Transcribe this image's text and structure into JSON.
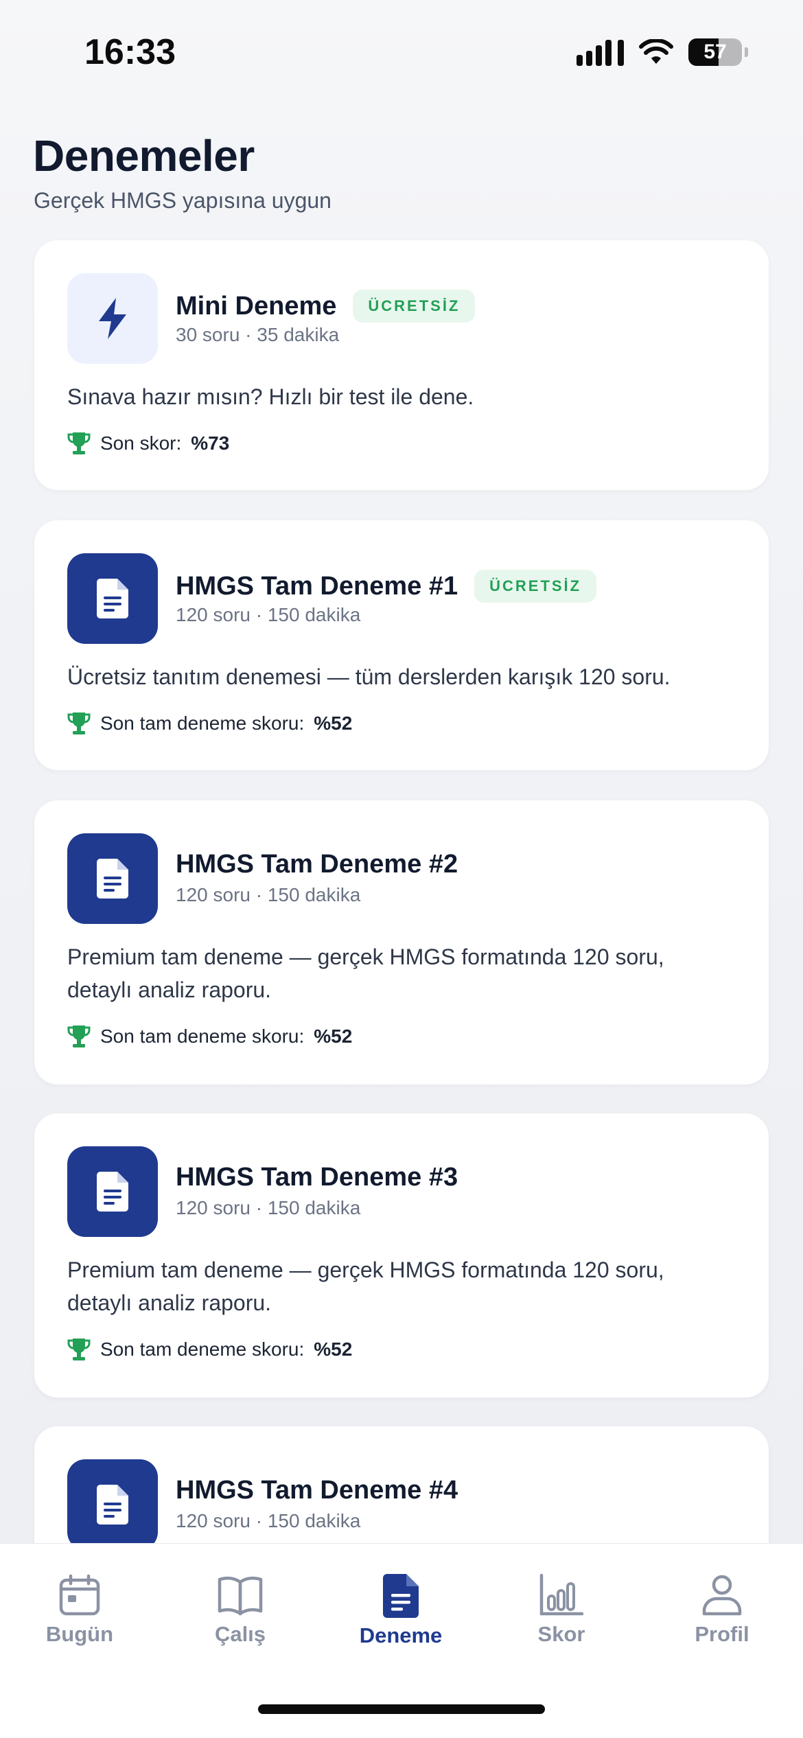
{
  "status_bar": {
    "time": "16:33",
    "battery_level": "57",
    "battery_fraction": 0.57
  },
  "header": {
    "title": "Denemeler",
    "subtitle": "Gerçek HMGS yapısına uygun"
  },
  "cards": [
    {
      "icon": "bolt-icon",
      "title": "Mini Deneme",
      "badge": "ÜCRETSİZ",
      "meta": "30 soru · 35 dakika",
      "description": "Sınava hazır mısın? Hızlı bir test ile dene.",
      "score_label": "Son skor:",
      "score_value": "%73"
    },
    {
      "icon": "document-icon",
      "title": "HMGS Tam Deneme #1",
      "badge": "ÜCRETSİZ",
      "meta": "120 soru · 150 dakika",
      "description": "Ücretsiz tanıtım denemesi — tüm derslerden karışık 120 soru.",
      "score_label": "Son tam deneme skoru:",
      "score_value": "%52"
    },
    {
      "icon": "document-icon",
      "title": "HMGS Tam Deneme #2",
      "meta": "120 soru · 150 dakika",
      "description": "Premium tam deneme — gerçek HMGS formatında 120 soru, detaylı analiz raporu.",
      "score_label": "Son tam deneme skoru:",
      "score_value": "%52"
    },
    {
      "icon": "document-icon",
      "title": "HMGS Tam Deneme #3",
      "meta": "120 soru · 150 dakika",
      "description": "Premium tam deneme — gerçek HMGS formatında 120 soru, detaylı analiz raporu.",
      "score_label": "Son tam deneme skoru:",
      "score_value": "%52"
    },
    {
      "icon": "document-icon",
      "title": "HMGS Tam Deneme #4",
      "meta": "120 soru · 150 dakika"
    }
  ],
  "tabs": [
    {
      "label": "Bugün",
      "icon": "calendar-icon",
      "active": false
    },
    {
      "label": "Çalış",
      "icon": "book-icon",
      "active": false
    },
    {
      "label": "Deneme",
      "icon": "document-icon",
      "active": true
    },
    {
      "label": "Skor",
      "icon": "bar-chart-icon",
      "active": false
    },
    {
      "label": "Profil",
      "icon": "user-icon",
      "active": false
    }
  ],
  "colors": {
    "primary": "#1f3a8f",
    "success": "#22a055",
    "badge_bg": "#e8f7ee",
    "inactive_tab": "#8a92a3"
  }
}
